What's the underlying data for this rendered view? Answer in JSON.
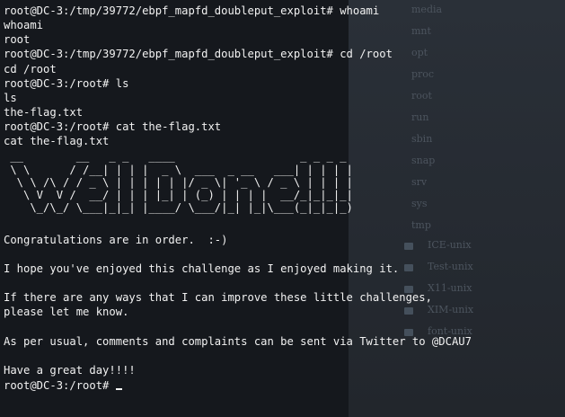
{
  "terminal": {
    "lines_top": [
      "root@DC-3:/tmp/39772/ebpf_mapfd_doubleput_exploit# whoami",
      "whoami",
      "root",
      "root@DC-3:/tmp/39772/ebpf_mapfd_doubleput_exploit# cd /root",
      "cd /root",
      "root@DC-3:/root# ls",
      "ls",
      "the-flag.txt",
      "root@DC-3:/root# cat the-flag.txt",
      "cat the-flag.txt"
    ],
    "ascii_art": " __        __   _ _   ____                   _ _ _ _ \n \\ \\      / /__| | | |  _ \\  ___  _ __   ___| | | | |\n  \\ \\ /\\ / / _ \\ | | | | | |/ _ \\| '_ \\ / _ \\ | | | |\n   \\ V  V /  __/ | | | |_| | (_) | | | |  __/_|_|_|_|\n    \\_/\\_/ \\___|_|_| |____/ \\___/|_| |_|\\___(_|_|_|_)",
    "lines_bottom": [
      "",
      "Congratulations are in order.  :-)",
      "",
      "I hope you've enjoyed this challenge as I enjoyed making it.",
      "",
      "If there are any ways that I can improve these little challenges,",
      "please let me know.",
      "",
      "As per usual, comments and complaints can be sent via Twitter to @DCAU7",
      "",
      "Have a great day!!!!",
      "root@DC-3:/root# "
    ]
  },
  "background_window": {
    "items": [
      "media",
      "mnt",
      "opt",
      "proc",
      "root",
      "run",
      "sbin",
      "snap",
      "srv",
      "sys",
      "tmp",
      "ICE-unix",
      "Test-unix",
      "X11-unix",
      "XIM-unix",
      "font-unix"
    ]
  }
}
